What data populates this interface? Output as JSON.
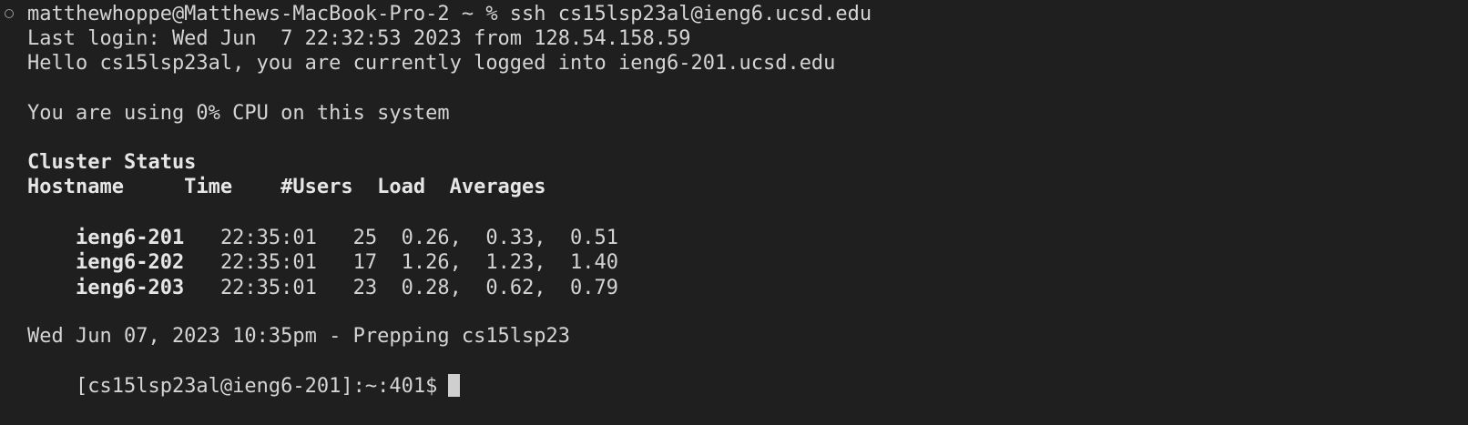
{
  "terminal": {
    "command_line": "matthewhoppe@Matthews-MacBook-Pro-2 ~ % ssh cs15lsp23al@ieng6.ucsd.edu",
    "last_login": "Last login: Wed Jun  7 22:32:53 2023 from 128.54.158.59",
    "hello": "Hello cs15lsp23al, you are currently logged into ieng6-201.ucsd.edu",
    "cpu": "You are using 0% CPU on this system",
    "cluster_title": "Cluster Status",
    "cluster_header": "Hostname     Time    #Users  Load  Averages",
    "rows": [
      {
        "host": "ieng6-201",
        "rest": "   22:35:01   25  0.26,  0.33,  0.51"
      },
      {
        "host": "ieng6-202",
        "rest": "   22:35:01   17  1.26,  1.23,  1.40"
      },
      {
        "host": "ieng6-203",
        "rest": "   22:35:01   23  0.28,  0.62,  0.79"
      }
    ],
    "date_line": "Wed Jun 07, 2023 10:35pm - Prepping cs15lsp23",
    "prompt": "[cs15lsp23al@ieng6-201]:~:401$"
  }
}
